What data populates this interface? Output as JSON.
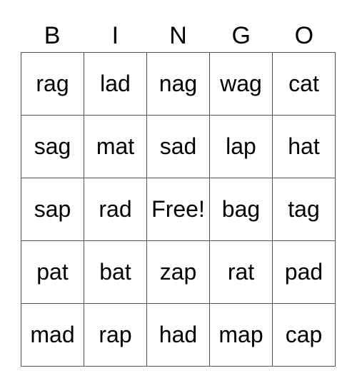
{
  "header": [
    "B",
    "I",
    "N",
    "G",
    "O"
  ],
  "cells": [
    [
      "rag",
      "lad",
      "nag",
      "wag",
      "cat"
    ],
    [
      "sag",
      "mat",
      "sad",
      "lap",
      "hat"
    ],
    [
      "sap",
      "rad",
      "Free!",
      "bag",
      "tag"
    ],
    [
      "pat",
      "bat",
      "zap",
      "rat",
      "pad"
    ],
    [
      "mad",
      "rap",
      "had",
      "map",
      "cap"
    ]
  ]
}
